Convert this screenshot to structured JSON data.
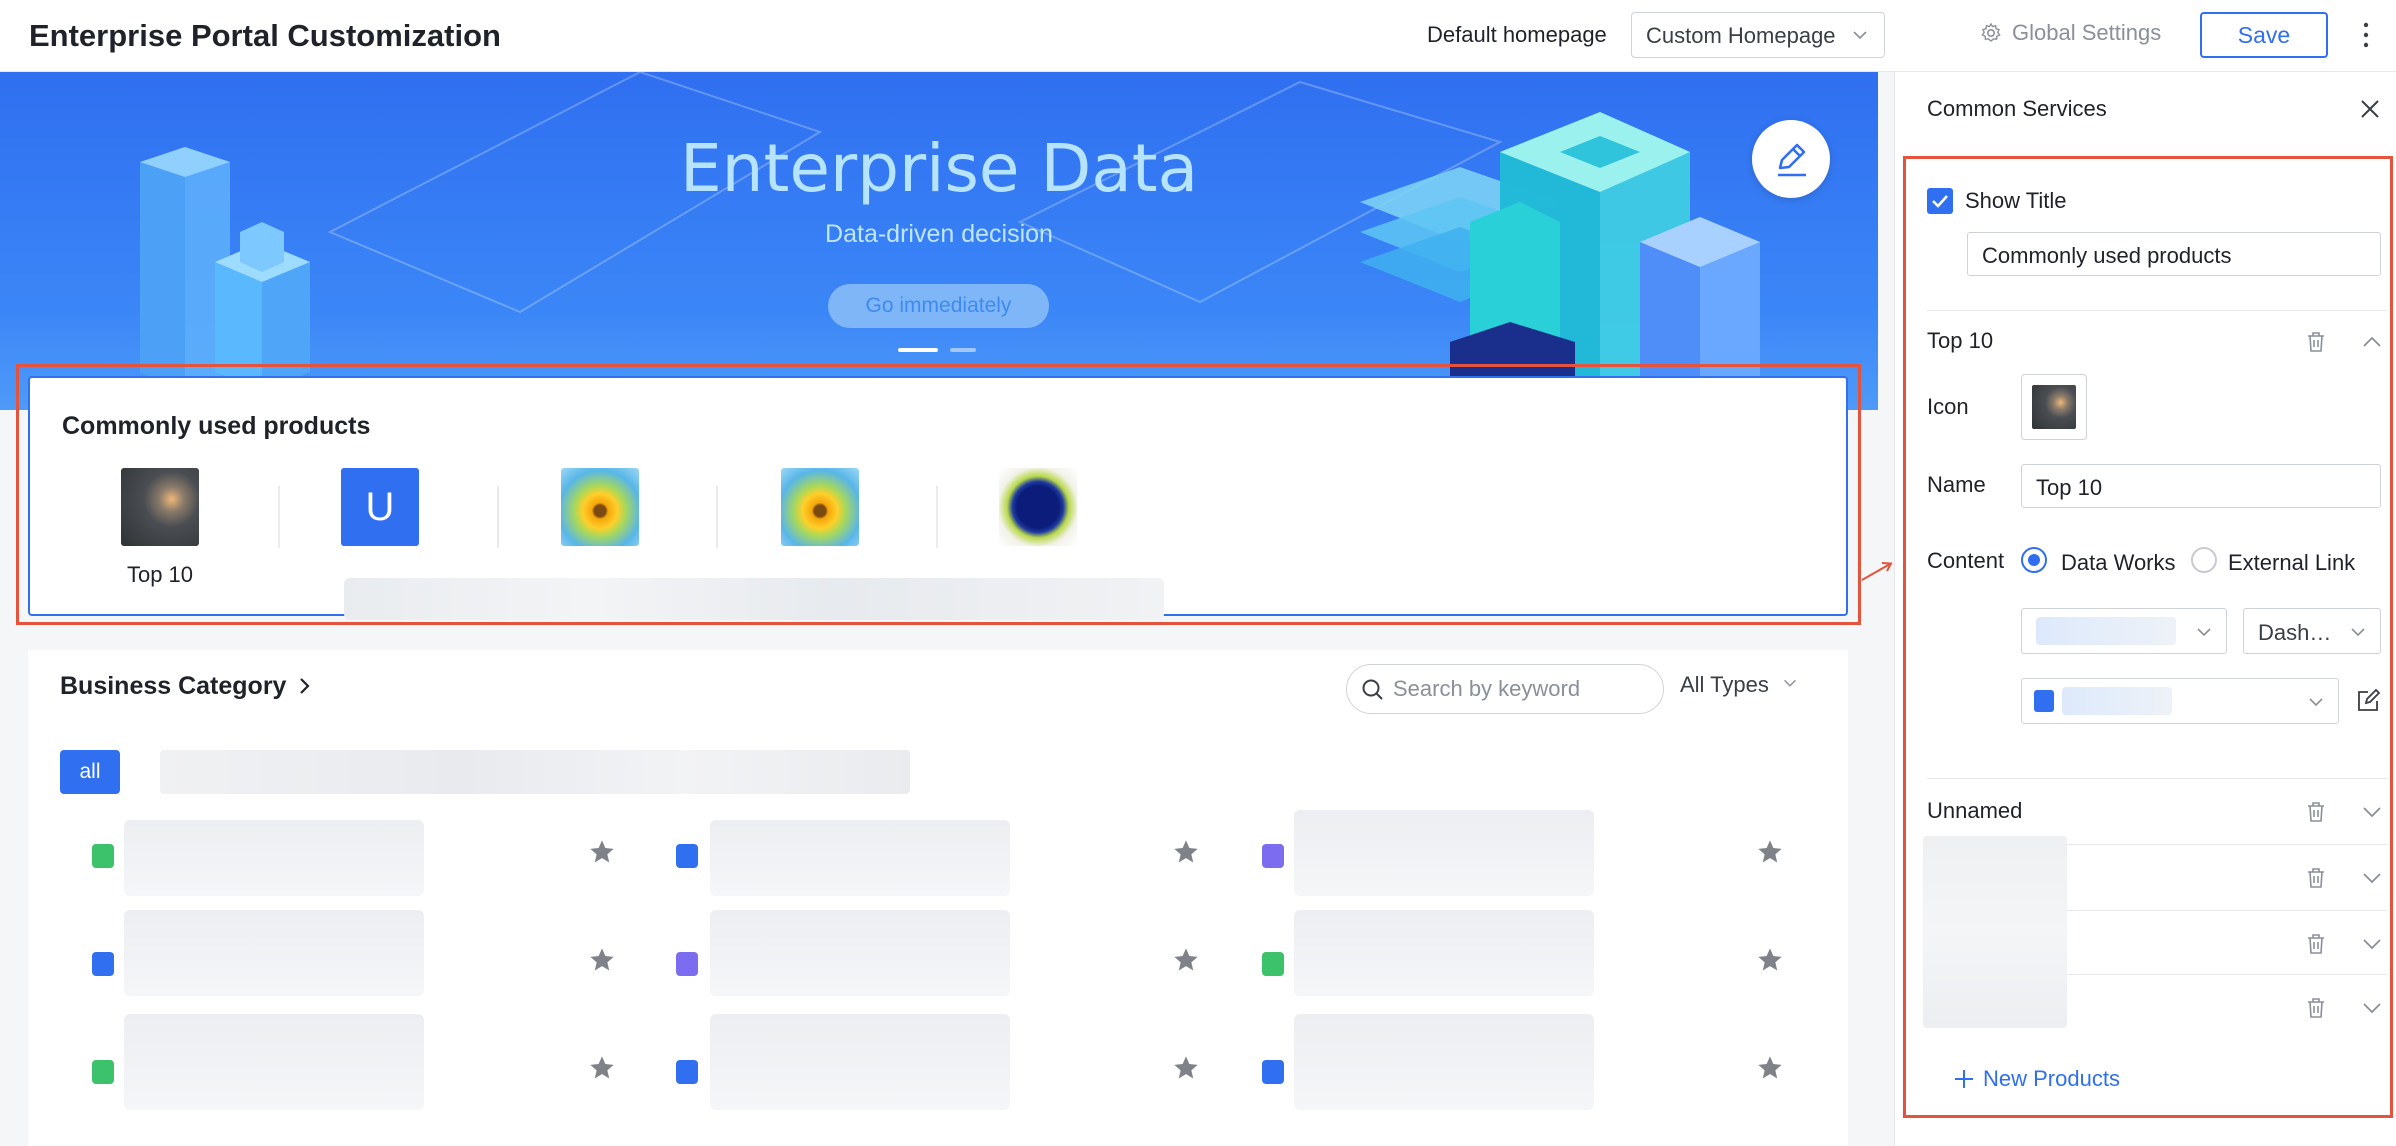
{
  "header": {
    "title": "Enterprise Portal Customization",
    "homepage_label": "Default homepage",
    "homepage_value": "Custom Homepage",
    "global_settings": "Global Settings",
    "save": "Save"
  },
  "banner": {
    "title": "Enterprise Data",
    "subtitle": "Data-driven decision",
    "button": "Go immediately"
  },
  "products": {
    "title": "Commonly used products",
    "items": [
      {
        "name": "Top 10",
        "icon": "dark-landscape-thumbnail"
      },
      {
        "name": "",
        "icon": "letter-u-tile",
        "letter": "U"
      },
      {
        "name": "",
        "icon": "sunflower-thumbnail"
      },
      {
        "name": "",
        "icon": "sunflower-thumbnail"
      },
      {
        "name": "",
        "icon": "blue-circle-thumbnail"
      }
    ]
  },
  "business": {
    "title": "Business Category",
    "search_placeholder": "Search by keyword",
    "types_filter": "All Types",
    "all_tag": "all"
  },
  "panel": {
    "title": "Common Services",
    "show_title_label": "Show Title",
    "show_title_checked": true,
    "title_value": "Commonly used products",
    "sections": [
      {
        "name": "Top 10",
        "expanded": true
      },
      {
        "name": "Unnamed",
        "expanded": false
      }
    ],
    "icon_label": "Icon",
    "name_label": "Name",
    "name_value": "Top 10",
    "content_label": "Content",
    "content_options": [
      "Data Works",
      "External Link"
    ],
    "content_selected": "Data Works",
    "dashboard_select": "Dash…",
    "new_products": "New Products"
  },
  "colors": {
    "accent": "#2f6ff0",
    "highlight_border": "#e5533d",
    "green_icon": "#3cc26b",
    "purple_icon": "#7c6cf0"
  }
}
